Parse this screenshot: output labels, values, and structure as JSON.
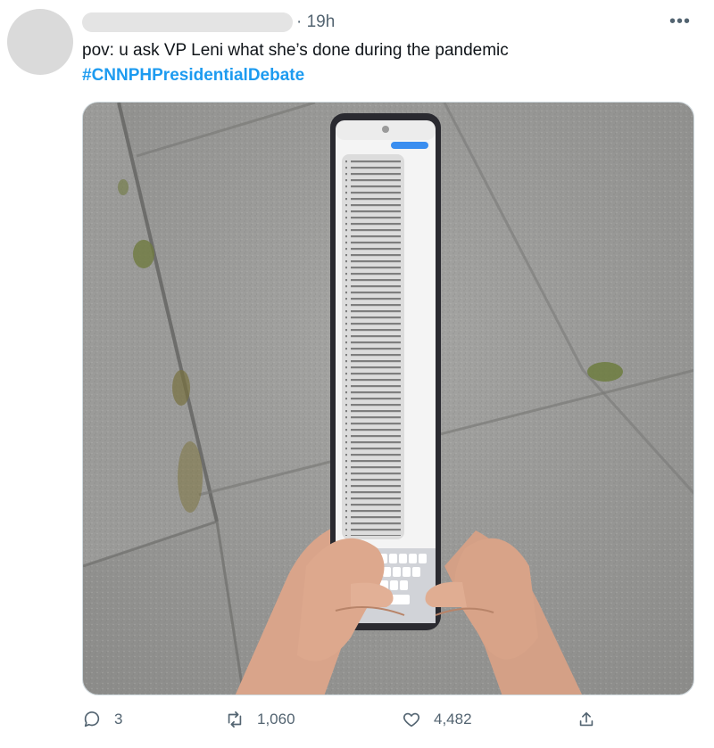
{
  "tweet": {
    "time": "19h",
    "text": "pov: u ask VP Leni what she’s done during the pandemic",
    "hashtag": "#CNNPHPresidentialDebate"
  },
  "more_icon": "more-icon",
  "media": {
    "subject": "hands holding a very tall elongated phone showing a long text message, on a concrete pavement"
  },
  "actions": {
    "reply_count": "3",
    "retweet_count": "1,060",
    "like_count": "4,482"
  },
  "colors": {
    "accent": "#1d9bf0",
    "muted": "#536471"
  }
}
